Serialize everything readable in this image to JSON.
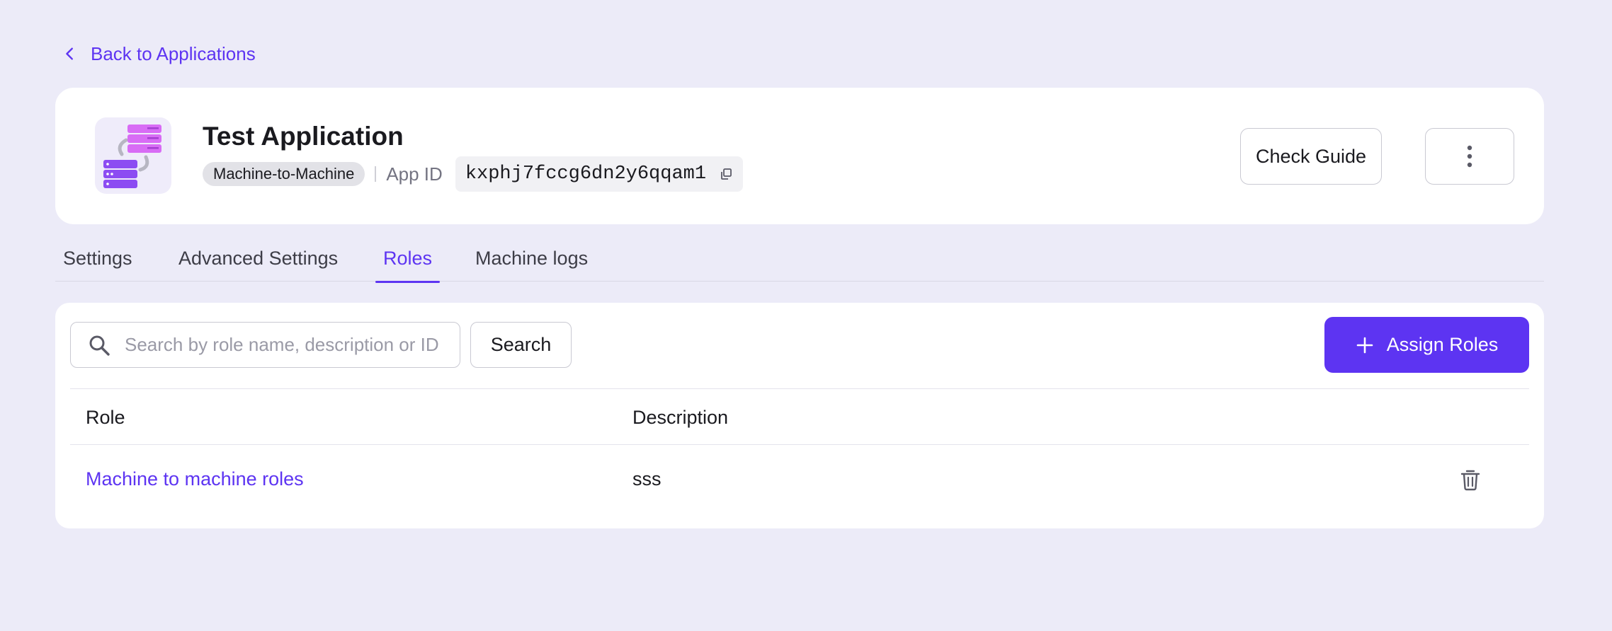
{
  "nav": {
    "back_label": "Back to Applications"
  },
  "app": {
    "title": "Test Application",
    "type_badge": "Machine-to-Machine",
    "app_id_label": "App ID",
    "app_id_value": "kxphj7fccg6dn2y6qqam1"
  },
  "actions": {
    "check_guide_label": "Check Guide"
  },
  "tabs": [
    {
      "label": "Settings",
      "active": false
    },
    {
      "label": "Advanced Settings",
      "active": false
    },
    {
      "label": "Roles",
      "active": true
    },
    {
      "label": "Machine logs",
      "active": false
    }
  ],
  "roles": {
    "search_placeholder": "Search by role name, description or ID",
    "search_value": "",
    "search_button": "Search",
    "assign_button": "Assign Roles",
    "columns": {
      "role": "Role",
      "description": "Description"
    },
    "rows": [
      {
        "role": "Machine to machine roles",
        "description": "sss"
      }
    ]
  },
  "colors": {
    "accent": "#5d34f2",
    "page_bg": "#ecebf8",
    "card_bg": "#ffffff"
  },
  "icons": [
    "chevron-left-icon",
    "app-logo-icon",
    "copy-icon",
    "more-vertical-icon",
    "search-icon",
    "plus-icon",
    "trash-icon"
  ]
}
